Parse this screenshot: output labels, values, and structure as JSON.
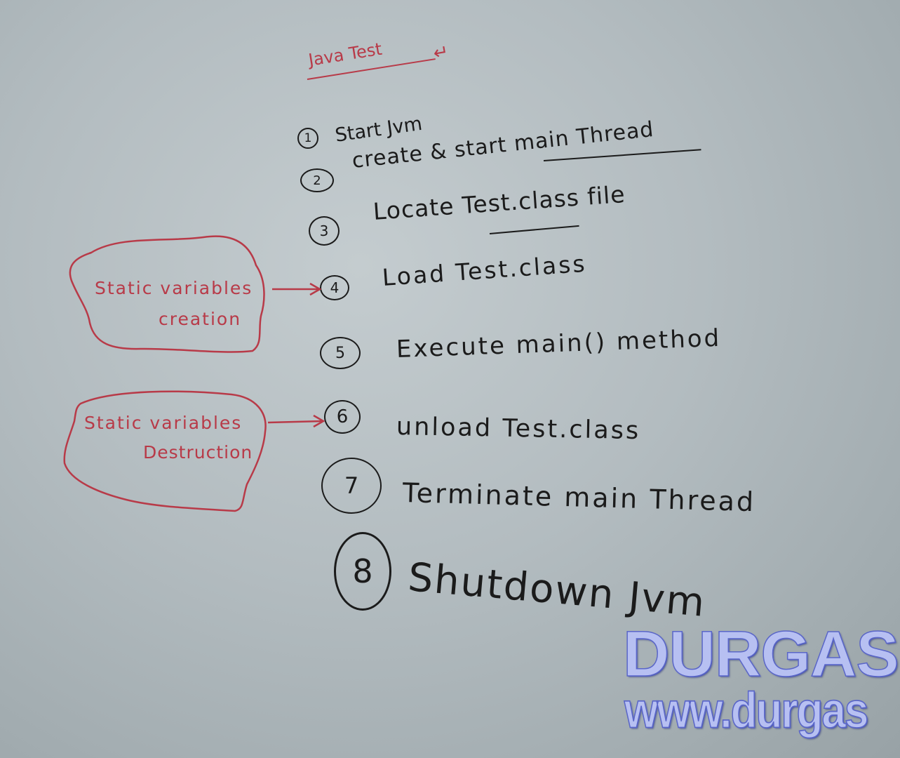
{
  "title": "Java Test",
  "steps": [
    {
      "num": "1",
      "text": "Start Jvm"
    },
    {
      "num": "2",
      "text": "create & start main Thread"
    },
    {
      "num": "3",
      "text": "Locate Test.class file"
    },
    {
      "num": "4",
      "text": "Load Test.class"
    },
    {
      "num": "5",
      "text": "Execute main() method"
    },
    {
      "num": "6",
      "text": "unload Test.class"
    },
    {
      "num": "7",
      "text": "Terminate main Thread"
    },
    {
      "num": "8",
      "text": "Shutdown Jvm"
    }
  ],
  "notes": {
    "creation_line1": "Static variables",
    "creation_line2": "creation",
    "destruction_line1": "Static variables",
    "destruction_line2": "Destruction"
  },
  "brand": {
    "name": "DURGAS",
    "url": "www.durgas"
  },
  "colors": {
    "ink": "#1b1b1b",
    "marker_red": "#b83a48",
    "brand_fill": "#b7c0f2",
    "brand_outline": "#5a66c8"
  }
}
